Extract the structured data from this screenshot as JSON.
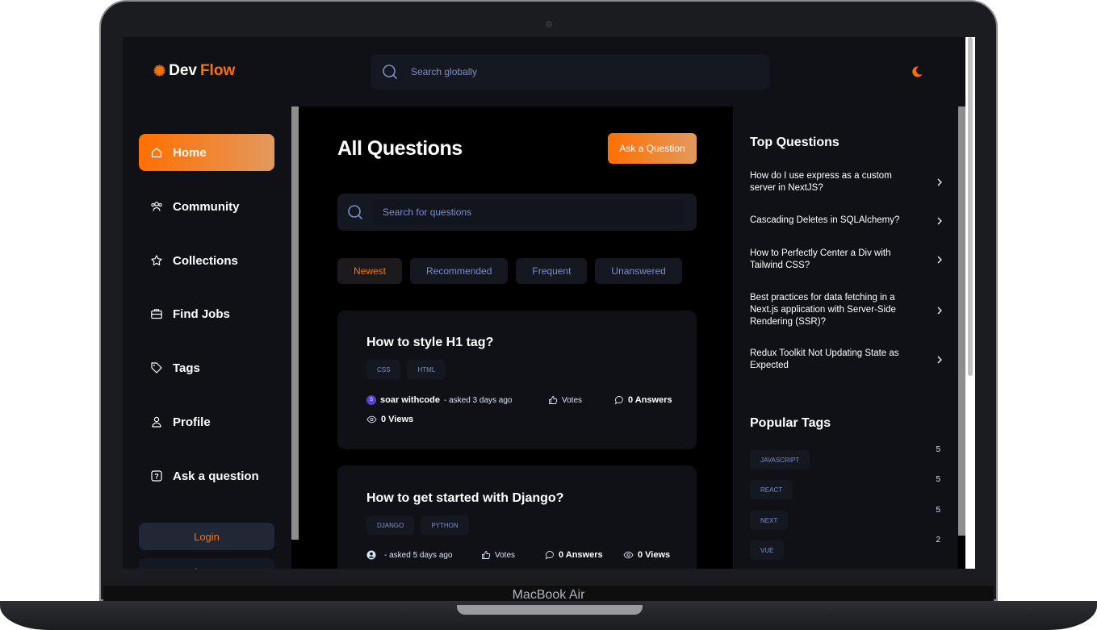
{
  "device": {
    "label": "MacBook Air"
  },
  "brand": {
    "name_part1": "Dev",
    "name_part2": "Flow"
  },
  "global_search": {
    "placeholder": "Search globally"
  },
  "sidebar": {
    "items": [
      {
        "label": "Home",
        "icon": "home-icon",
        "active": true
      },
      {
        "label": "Community",
        "icon": "users-icon"
      },
      {
        "label": "Collections",
        "icon": "star-icon"
      },
      {
        "label": "Find Jobs",
        "icon": "suitcase-icon"
      },
      {
        "label": "Tags",
        "icon": "tag-icon"
      },
      {
        "label": "Profile",
        "icon": "user-icon"
      },
      {
        "label": "Ask a question",
        "icon": "question-icon"
      }
    ],
    "login_label": "Login",
    "signup_label": "Sign Up"
  },
  "main": {
    "title": "All Questions",
    "ask_button": "Ask a Question",
    "search_placeholder": "Search for questions",
    "filters": [
      "Newest",
      "Recommended",
      "Frequent",
      "Unanswered"
    ],
    "questions": [
      {
        "title": "How to style H1 tag?",
        "tags": [
          "CSS",
          "HTML"
        ],
        "author": "soar withcode",
        "author_initial": "S",
        "asked": " - asked 3 days ago",
        "votes": "Votes",
        "answers": "0 Answers",
        "views": "0 Views"
      },
      {
        "title": "How to get started with Django?",
        "tags": [
          "DJANGO",
          "PYTHON"
        ],
        "author": "",
        "asked": " - asked 5 days ago",
        "votes": "Votes",
        "answers": "0 Answers",
        "views": "0 Views"
      }
    ]
  },
  "right": {
    "top_title": "Top Questions",
    "top_questions": [
      "How do I use express as a custom server in NextJS?",
      "Cascading Deletes in SQLAlchemy?",
      "How to Perfectly Center a Div with Tailwind CSS?",
      "Best practices for data fetching in a Next.js application with Server-Side Rendering (SSR)?",
      "Redux Toolkit Not Updating State as Expected"
    ],
    "tags_title": "Popular Tags",
    "popular_tags": [
      {
        "name": "JAVASCRIPT",
        "count": "5"
      },
      {
        "name": "REACT",
        "count": "5"
      },
      {
        "name": "NEXT",
        "count": "5"
      },
      {
        "name": "VUE",
        "count": "2"
      }
    ]
  },
  "colors": {
    "accent": "#ff7000",
    "accent_light": "#e2995f",
    "bg": "#000000",
    "panel": "#0f1117",
    "muted_text": "#7b8ec8"
  }
}
